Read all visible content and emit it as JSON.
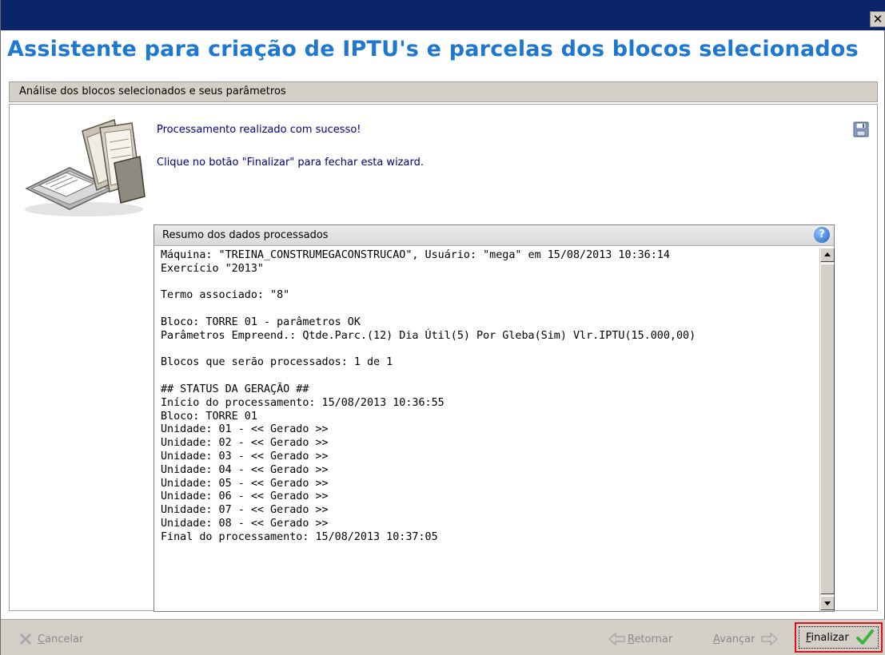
{
  "window": {
    "close_glyph": "✕",
    "title": "Assistente para criação de IPTU's e parcelas dos blocos selecionados"
  },
  "section": {
    "label": "Análise dos blocos selecionados e seus parâmetros"
  },
  "messages": {
    "line1": "Processamento realizado com sucesso!",
    "line2": "Clique no botão \"Finalizar\" para fechar esta wizard."
  },
  "summary": {
    "title": "Resumo dos dados processados",
    "help_glyph": "?",
    "log": "Máquina: \"TREINA_CONSTRUMEGACONSTRUCAO\", Usuário: \"mega\" em 15/08/2013 10:36:14\nExercício \"2013\"\n\nTermo associado: \"8\"\n\nBloco: TORRE 01 - parâmetros OK\nParâmetros Empreend.: Qtde.Parc.(12) Dia Útil(5) Por Gleba(Sim) Vlr.IPTU(15.000,00)\n\nBlocos que serão processados: 1 de 1\n\n## STATUS DA GERAÇÃO ##\nInício do processamento: 15/08/2013 10:36:55\nBloco: TORRE 01\nUnidade: 01 - << Gerado >>\nUnidade: 02 - << Gerado >>\nUnidade: 03 - << Gerado >>\nUnidade: 04 - << Gerado >>\nUnidade: 05 - << Gerado >>\nUnidade: 06 - << Gerado >>\nUnidade: 07 - << Gerado >>\nUnidade: 08 - << Gerado >>\nFinal do processamento: 15/08/2013 10:37:05"
  },
  "buttons": {
    "cancel": {
      "underlined": "C",
      "rest": "ancelar",
      "icon": "x-icon",
      "enabled": false
    },
    "back": {
      "underlined": "R",
      "rest": "etornar",
      "icon": "arrow-left-icon",
      "enabled": false
    },
    "next": {
      "underlined": "A",
      "rest": "vançar",
      "icon": "arrow-right-icon",
      "enabled": false
    },
    "finish": {
      "underlined": "F",
      "rest": "inalizar",
      "icon": "checkmark-icon",
      "enabled": true
    }
  },
  "colors": {
    "titlebar": "#0a246a",
    "header_title": "#1e78d2",
    "message_text": "#000080",
    "finish_highlight": "#e0101a",
    "check_green": "#3cb43c"
  }
}
